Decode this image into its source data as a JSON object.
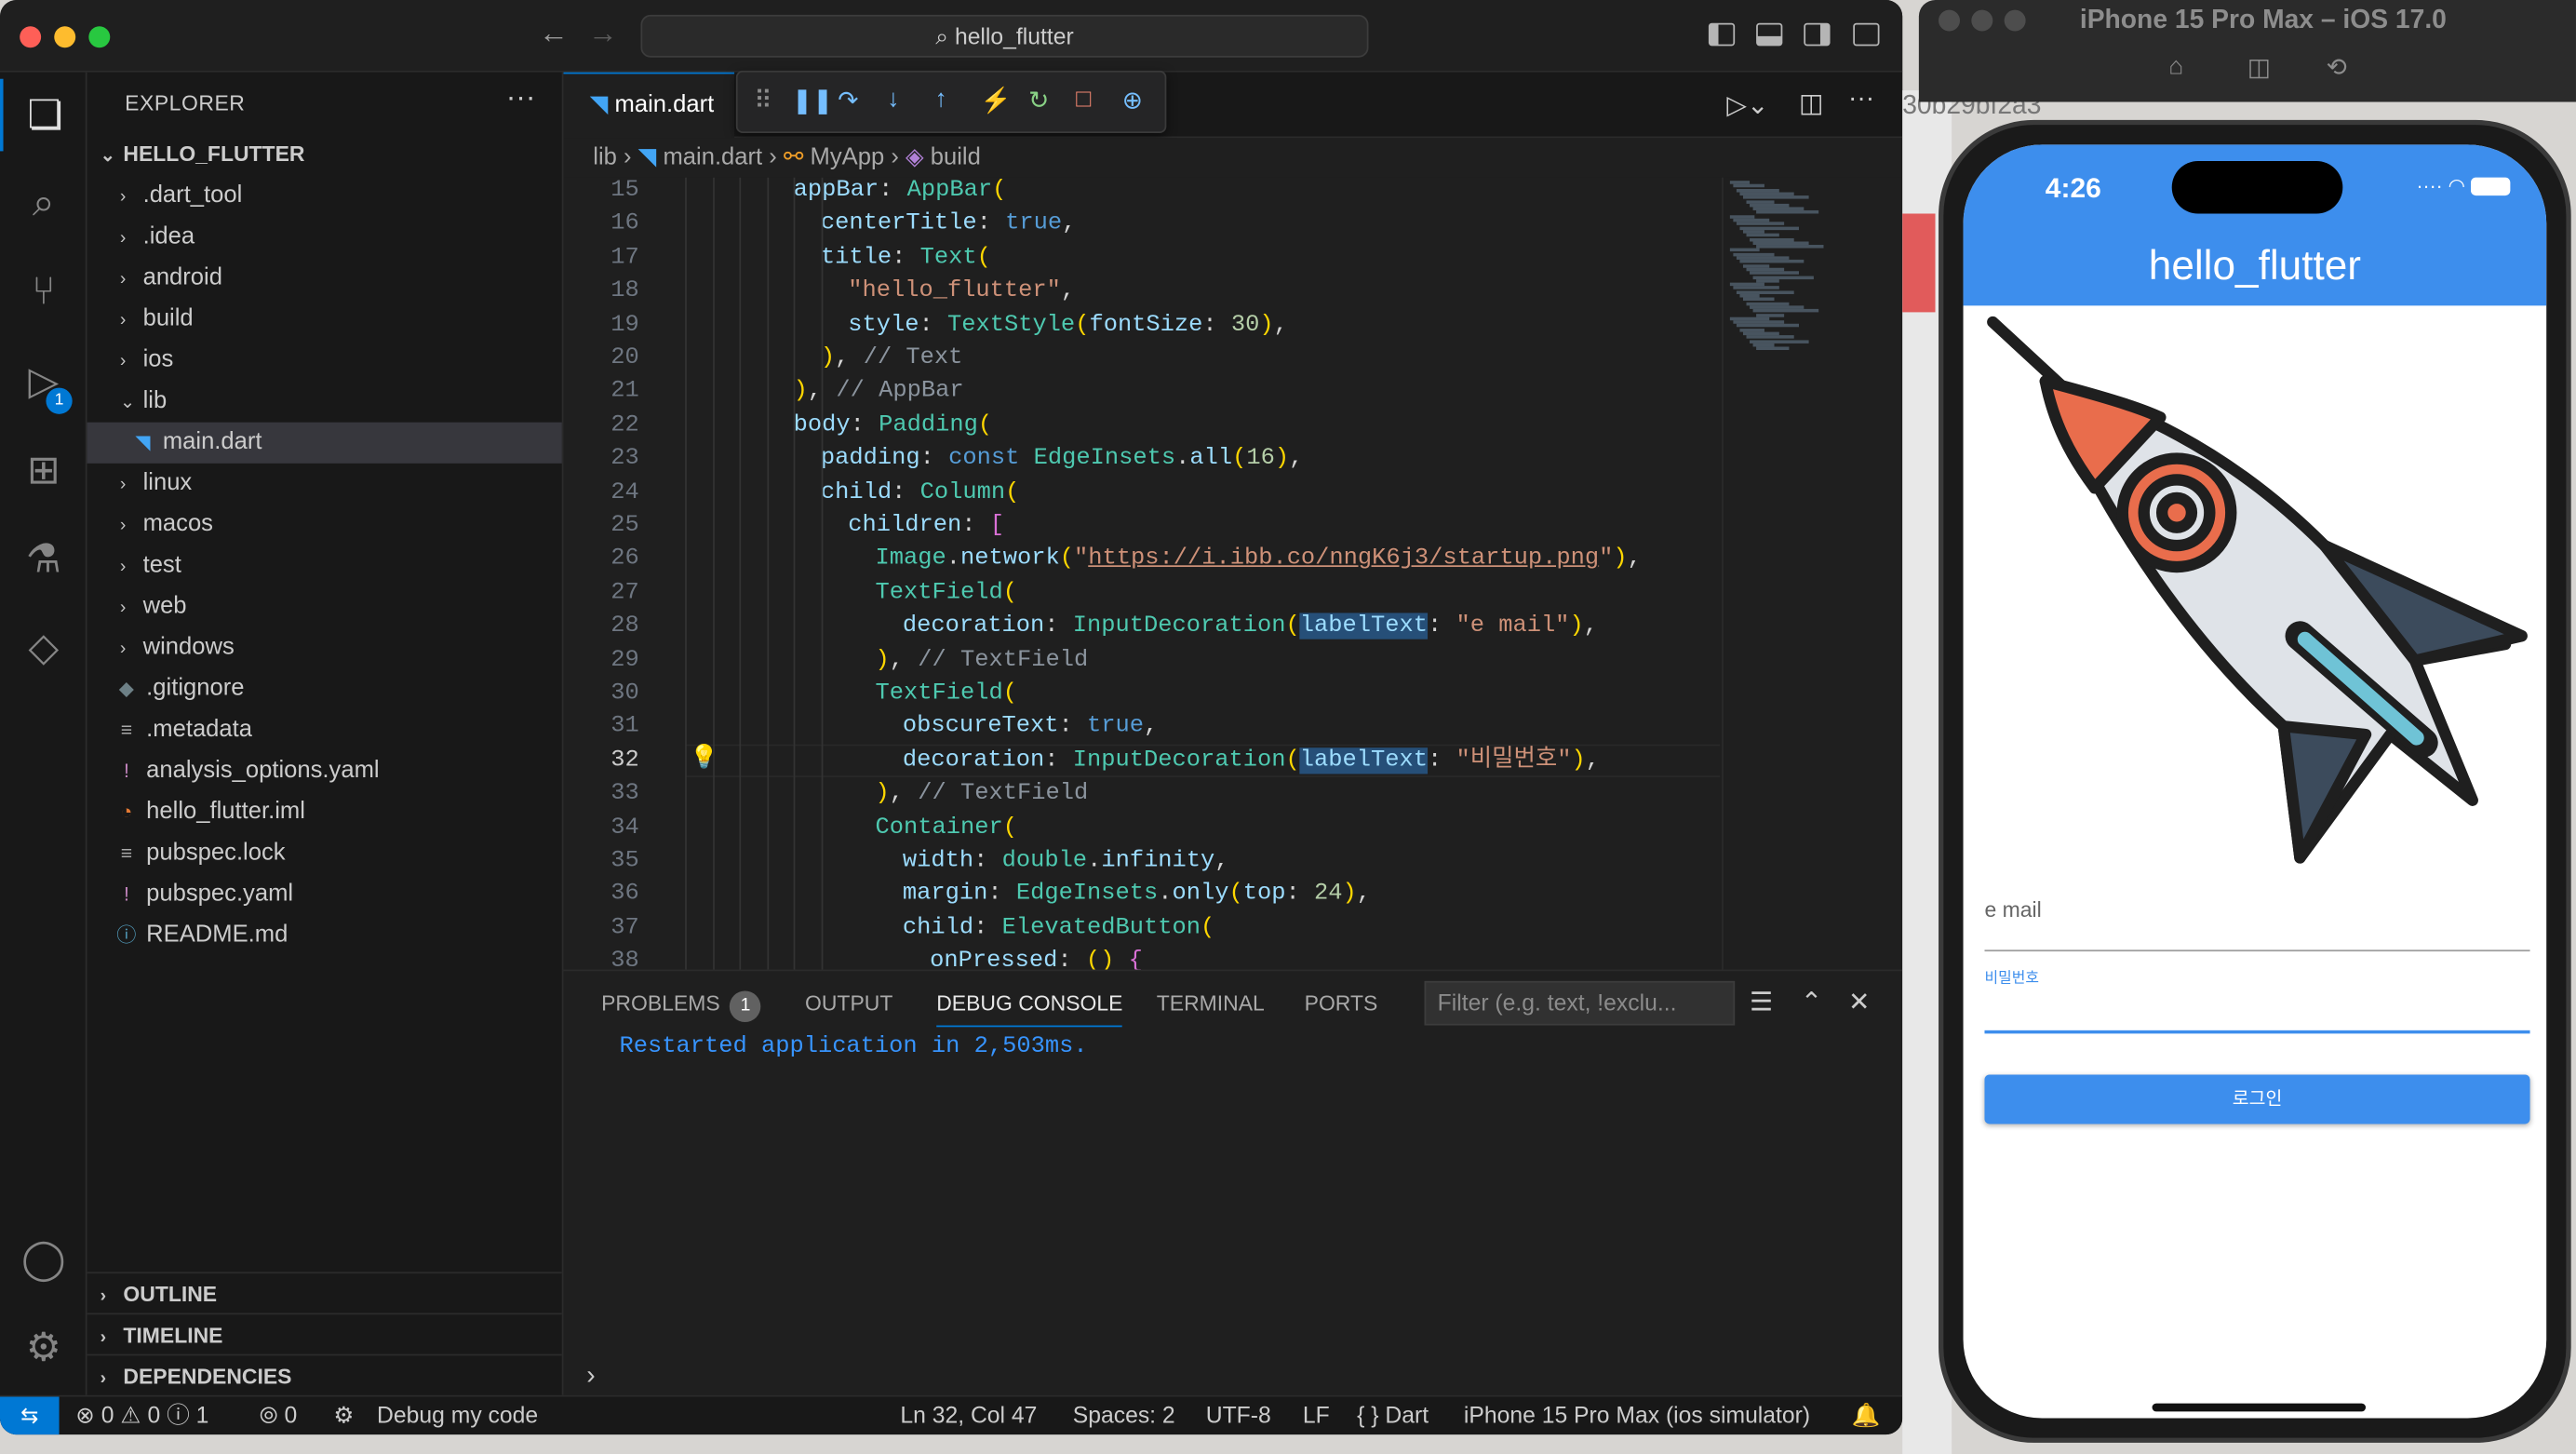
{
  "window": {
    "title": "hello_flutter"
  },
  "explorer": {
    "title": "EXPLORER",
    "more": "···",
    "root": "HELLO_FLUTTER",
    "items": [
      {
        "label": ".dart_tool",
        "kind": "folder"
      },
      {
        "label": ".idea",
        "kind": "folder"
      },
      {
        "label": "android",
        "kind": "folder"
      },
      {
        "label": "build",
        "kind": "folder"
      },
      {
        "label": "ios",
        "kind": "folder"
      },
      {
        "label": "lib",
        "kind": "folder-open"
      },
      {
        "label": "main.dart",
        "kind": "dart-file"
      },
      {
        "label": "linux",
        "kind": "folder"
      },
      {
        "label": "macos",
        "kind": "folder"
      },
      {
        "label": "test",
        "kind": "folder"
      },
      {
        "label": "web",
        "kind": "folder"
      },
      {
        "label": "windows",
        "kind": "folder"
      },
      {
        "label": ".gitignore",
        "kind": "git-file"
      },
      {
        "label": ".metadata",
        "kind": "text-file"
      },
      {
        "label": "analysis_options.yaml",
        "kind": "yaml-file"
      },
      {
        "label": "hello_flutter.iml",
        "kind": "rss-file"
      },
      {
        "label": "pubspec.lock",
        "kind": "text-file"
      },
      {
        "label": "pubspec.yaml",
        "kind": "yaml-file"
      },
      {
        "label": "README.md",
        "kind": "info-file"
      }
    ],
    "sections": [
      "OUTLINE",
      "TIMELINE",
      "DEPENDENCIES"
    ]
  },
  "activity_bar": {
    "debug_badge": "1"
  },
  "editor": {
    "tab": "main.dart",
    "breadcrumb": [
      "lib",
      "main.dart",
      "MyApp",
      "build"
    ],
    "current_line": 32,
    "lines": [
      {
        "n": "15",
        "code": "appBar: AppBar("
      },
      {
        "n": "16",
        "code": "centerTitle: true,"
      },
      {
        "n": "17",
        "code": "title: Text("
      },
      {
        "n": "18",
        "code": "\"hello_flutter\","
      },
      {
        "n": "19",
        "code": "style: TextStyle(fontSize: 30),"
      },
      {
        "n": "20",
        "code": "), // Text"
      },
      {
        "n": "21",
        "code": "), // AppBar"
      },
      {
        "n": "22",
        "code": "body: Padding("
      },
      {
        "n": "23",
        "code": "padding: const EdgeInsets.all(16),"
      },
      {
        "n": "24",
        "code": "child: Column("
      },
      {
        "n": "25",
        "code": "children: ["
      },
      {
        "n": "26",
        "code": "Image.network(\"https://i.ibb.co/nngK6j3/startup.png\"),"
      },
      {
        "n": "27",
        "code": "TextField("
      },
      {
        "n": "28",
        "code": "decoration: InputDecoration(labelText: \"e mail\"),"
      },
      {
        "n": "29",
        "code": "), // TextField"
      },
      {
        "n": "30",
        "code": "TextField("
      },
      {
        "n": "31",
        "code": "obscureText: true,"
      },
      {
        "n": "32",
        "code": "decoration: InputDecoration(labelText: \"비밀번호\"),"
      },
      {
        "n": "33",
        "code": "), // TextField"
      },
      {
        "n": "34",
        "code": "Container("
      },
      {
        "n": "35",
        "code": "width: double.infinity,"
      },
      {
        "n": "36",
        "code": "margin: EdgeInsets.only(top: 24),"
      },
      {
        "n": "37",
        "code": "child: ElevatedButton("
      },
      {
        "n": "38",
        "code": "onPressed: () {"
      }
    ]
  },
  "panel": {
    "tabs": [
      "PROBLEMS",
      "OUTPUT",
      "DEBUG CONSOLE",
      "TERMINAL",
      "PORTS"
    ],
    "problems_count": "1",
    "active_tab": "DEBUG CONSOLE",
    "filter_placeholder": "Filter (e.g. text, !exclu...",
    "output": "Restarted application in 2,503ms."
  },
  "statusbar": {
    "errors": "0",
    "warnings": "0",
    "infos": "1",
    "ports": "0",
    "debug_label": "Debug my code",
    "position": "Ln 32, Col 47",
    "spaces": "Spaces: 2",
    "encoding": "UTF-8",
    "eol": "LF",
    "language": "Dart",
    "device": "iPhone 15 Pro Max (ios simulator)"
  },
  "simulator": {
    "title": "iPhone 15 Pro Max – iOS 17.0",
    "behind_text": "30b29bf2a3",
    "status_time": "4:26",
    "app_title": "hello_flutter",
    "email_label": "e mail",
    "password_label": "비밀번호",
    "login_button": "로그인"
  },
  "colors": {
    "accent": "#0078d4",
    "appbar": "#3d8eed",
    "rocket_orange": "#e96d4c",
    "rocket_dark": "#3c4b5c"
  }
}
